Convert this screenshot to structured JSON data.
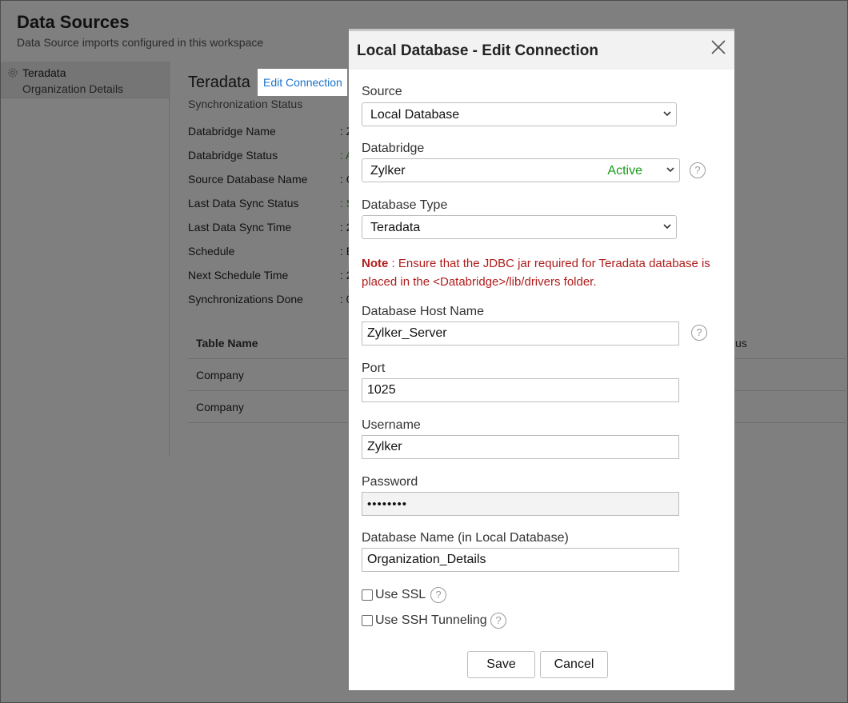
{
  "page": {
    "title": "Data Sources",
    "subtitle": "Data Source imports configured in this workspace"
  },
  "sidebar": {
    "items": [
      {
        "name": "Teradata",
        "sub": "Organization Details",
        "icon": "gear-icon"
      }
    ]
  },
  "detail": {
    "title": "Teradata",
    "edit_link": "Edit Connection",
    "sync_status_label": "Synchronization Status",
    "rows": [
      {
        "label": "Databridge Name",
        "value": ": Z"
      },
      {
        "label": "Databridge Status",
        "value": ": A"
      },
      {
        "label": "Source Database Name",
        "value": ": O"
      },
      {
        "label": "Last Data Sync Status",
        "value": ": S"
      },
      {
        "label": "Last Data Sync Time",
        "value": ": 2"
      },
      {
        "label": "Schedule",
        "value": ": E"
      },
      {
        "label": "Next Schedule Time",
        "value": ": 2"
      },
      {
        "label": "Synchronizations Done",
        "value": ": 0"
      }
    ],
    "table": {
      "header": "Table Name",
      "header_right": "us",
      "rows": [
        "Company",
        "Company"
      ]
    }
  },
  "modal": {
    "title": "Local Database - Edit Connection",
    "source": {
      "label": "Source",
      "value": "Local Database"
    },
    "databridge": {
      "label": "Databridge",
      "value": "Zylker",
      "status": "Active"
    },
    "database_type": {
      "label": "Database Type",
      "value": "Teradata"
    },
    "note": {
      "prefix": "Note",
      "text": " : Ensure that the JDBC jar required for Teradata database is placed in the <Databridge>/lib/drivers folder."
    },
    "host": {
      "label": "Database Host Name",
      "value": "Zylker_Server"
    },
    "port": {
      "label": "Port",
      "value": "1025"
    },
    "username": {
      "label": "Username",
      "value": "Zylker"
    },
    "password": {
      "label": "Password",
      "value": "••••••••"
    },
    "dbname": {
      "label": "Database Name (in Local Database)",
      "value": "Organization_Details"
    },
    "use_ssl": {
      "label": "Use SSL",
      "checked": false
    },
    "use_ssh": {
      "label": "Use SSH Tunneling",
      "checked": false
    },
    "save_label": "Save",
    "cancel_label": "Cancel",
    "help_glyph": "?"
  },
  "colors": {
    "link": "#1a73c8",
    "active_green": "#1a9a1a",
    "note_red": "#b01c1c"
  }
}
